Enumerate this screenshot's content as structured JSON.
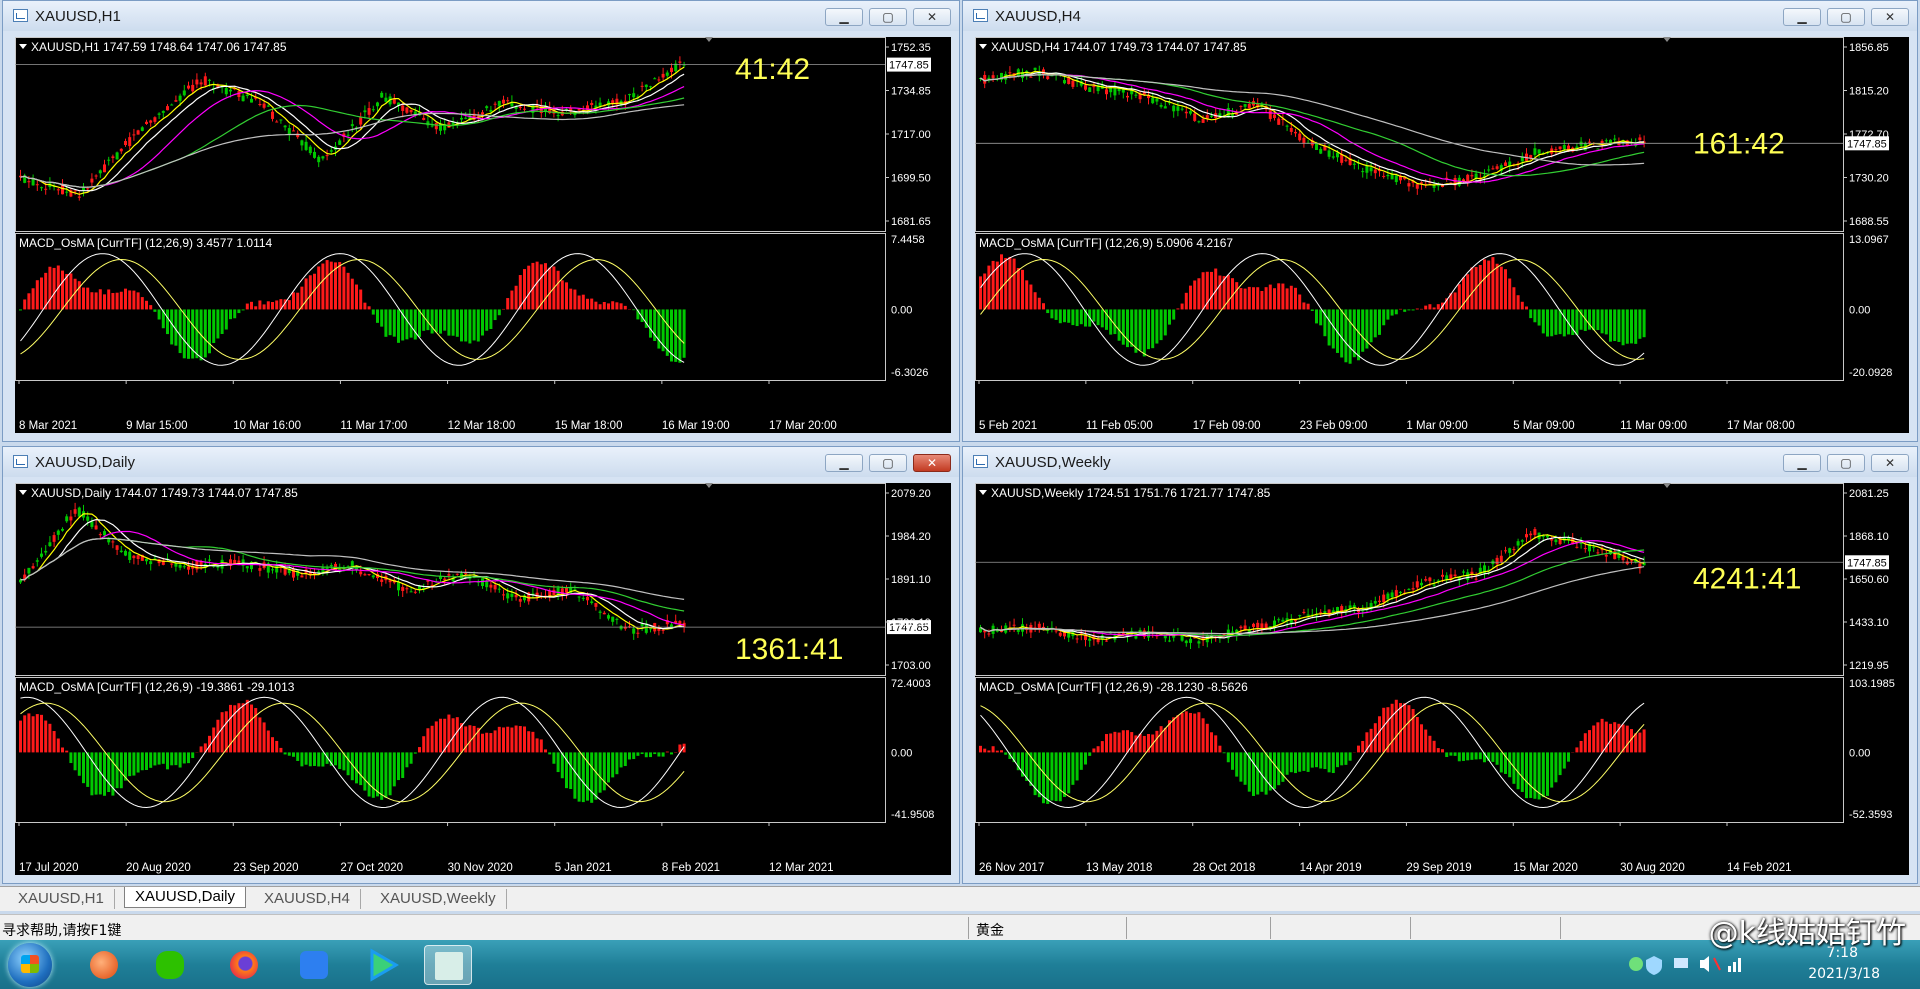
{
  "windows": [
    {
      "title": "XAUUSD,H1",
      "header": "XAUUSD,H1  1747.59 1748.64 1747.06 1747.85",
      "timer": "41:42",
      "macd_header": "MACD_OsMA [CurrTF] (12,26,9) 3.4577 1.0114",
      "price_ticks": [
        "1752.35",
        "1734.85",
        "1717.00",
        "1699.50",
        "1681.65"
      ],
      "current_price": "1747.85",
      "macd_ticks": [
        "7.4458",
        "0.00",
        "-6.3026"
      ],
      "time_ticks": [
        "8 Mar 2021",
        "9 Mar 15:00",
        "10 Mar 16:00",
        "11 Mar 17:00",
        "12 Mar 18:00",
        "15 Mar 18:00",
        "16 Mar 19:00",
        "17 Mar 20:00"
      ],
      "close_red": false
    },
    {
      "title": "XAUUSD,H4",
      "header": "XAUUSD,H4  1744.07 1749.73 1744.07 1747.85",
      "timer": "161:42",
      "macd_header": "MACD_OsMA [CurrTF] (12,26,9) 5.0906 4.2167",
      "price_ticks": [
        "1856.85",
        "1815.20",
        "1772.70",
        "1730.20",
        "1688.55"
      ],
      "current_price": "1747.85",
      "macd_ticks": [
        "13.0967",
        "0.00",
        "-20.0928"
      ],
      "time_ticks": [
        "5 Feb 2021",
        "11 Feb 05:00",
        "17 Feb 09:00",
        "23 Feb 09:00",
        "1 Mar 09:00",
        "5 Mar 09:00",
        "11 Mar 09:00",
        "17 Mar 08:00"
      ],
      "close_red": false
    },
    {
      "title": "XAUUSD,Daily",
      "header": "XAUUSD,Daily  1744.07 1749.73 1744.07 1747.85",
      "timer": "1361:41",
      "macd_header": "MACD_OsMA [CurrTF] (12,26,9) -19.3861 -29.1013",
      "price_ticks": [
        "2079.20",
        "1984.20",
        "1891.10",
        "1796.10",
        "1703.00"
      ],
      "current_price": "1747.85",
      "macd_ticks": [
        "72.4003",
        "0.00",
        "-41.9508"
      ],
      "time_ticks": [
        "17 Jul 2020",
        "20 Aug 2020",
        "23 Sep 2020",
        "27 Oct 2020",
        "30 Nov 2020",
        "5 Jan 2021",
        "8 Feb 2021",
        "12 Mar 2021"
      ],
      "close_red": true
    },
    {
      "title": "XAUUSD,Weekly",
      "header": "XAUUSD,Weekly  1724.51 1751.76 1721.77 1747.85",
      "timer": "4241:41",
      "macd_header": "MACD_OsMA [CurrTF] (12,26,9) -28.1230 -8.5626",
      "price_ticks": [
        "2081.25",
        "1868.10",
        "1650.60",
        "1433.10",
        "1219.95"
      ],
      "current_price": "1747.85",
      "macd_ticks": [
        "103.1985",
        "0.00",
        "-52.3593"
      ],
      "time_ticks": [
        "26 Nov 2017",
        "13 May 2018",
        "28 Oct 2018",
        "14 Apr 2019",
        "29 Sep 2019",
        "15 Mar 2020",
        "30 Aug 2020",
        "14 Feb 2021"
      ],
      "close_red": false
    }
  ],
  "window_buttons": {
    "minimize": "▁",
    "maximize": "▢",
    "close": "✕"
  },
  "tabs": [
    "XAUUSD,H1",
    "XAUUSD,Daily",
    "XAUUSD,H4",
    "XAUUSD,Weekly"
  ],
  "active_tab": "XAUUSD,Daily",
  "status": {
    "help": "寻求帮助,请按F1键",
    "symbol": "黄金"
  },
  "taskbar": {
    "time": "7:18",
    "date": "2021/3/18"
  },
  "watermark": "@k线姑姑钉竹",
  "colors": {
    "bull": "#00c800",
    "bear": "#ff1a1a",
    "ma_yellow": "#ffff00",
    "ma_white": "#ffffff",
    "ma_magenta": "#ff00ff",
    "ma_green": "#32cd32",
    "ma_gray": "#c0c0c0",
    "timer": "#ffff55"
  },
  "icons": [
    "windows-start-icon",
    "swirl-app-icon",
    "wechat-icon",
    "firefox-icon",
    "pen-icon",
    "play-icon",
    "terminal-icon"
  ]
}
